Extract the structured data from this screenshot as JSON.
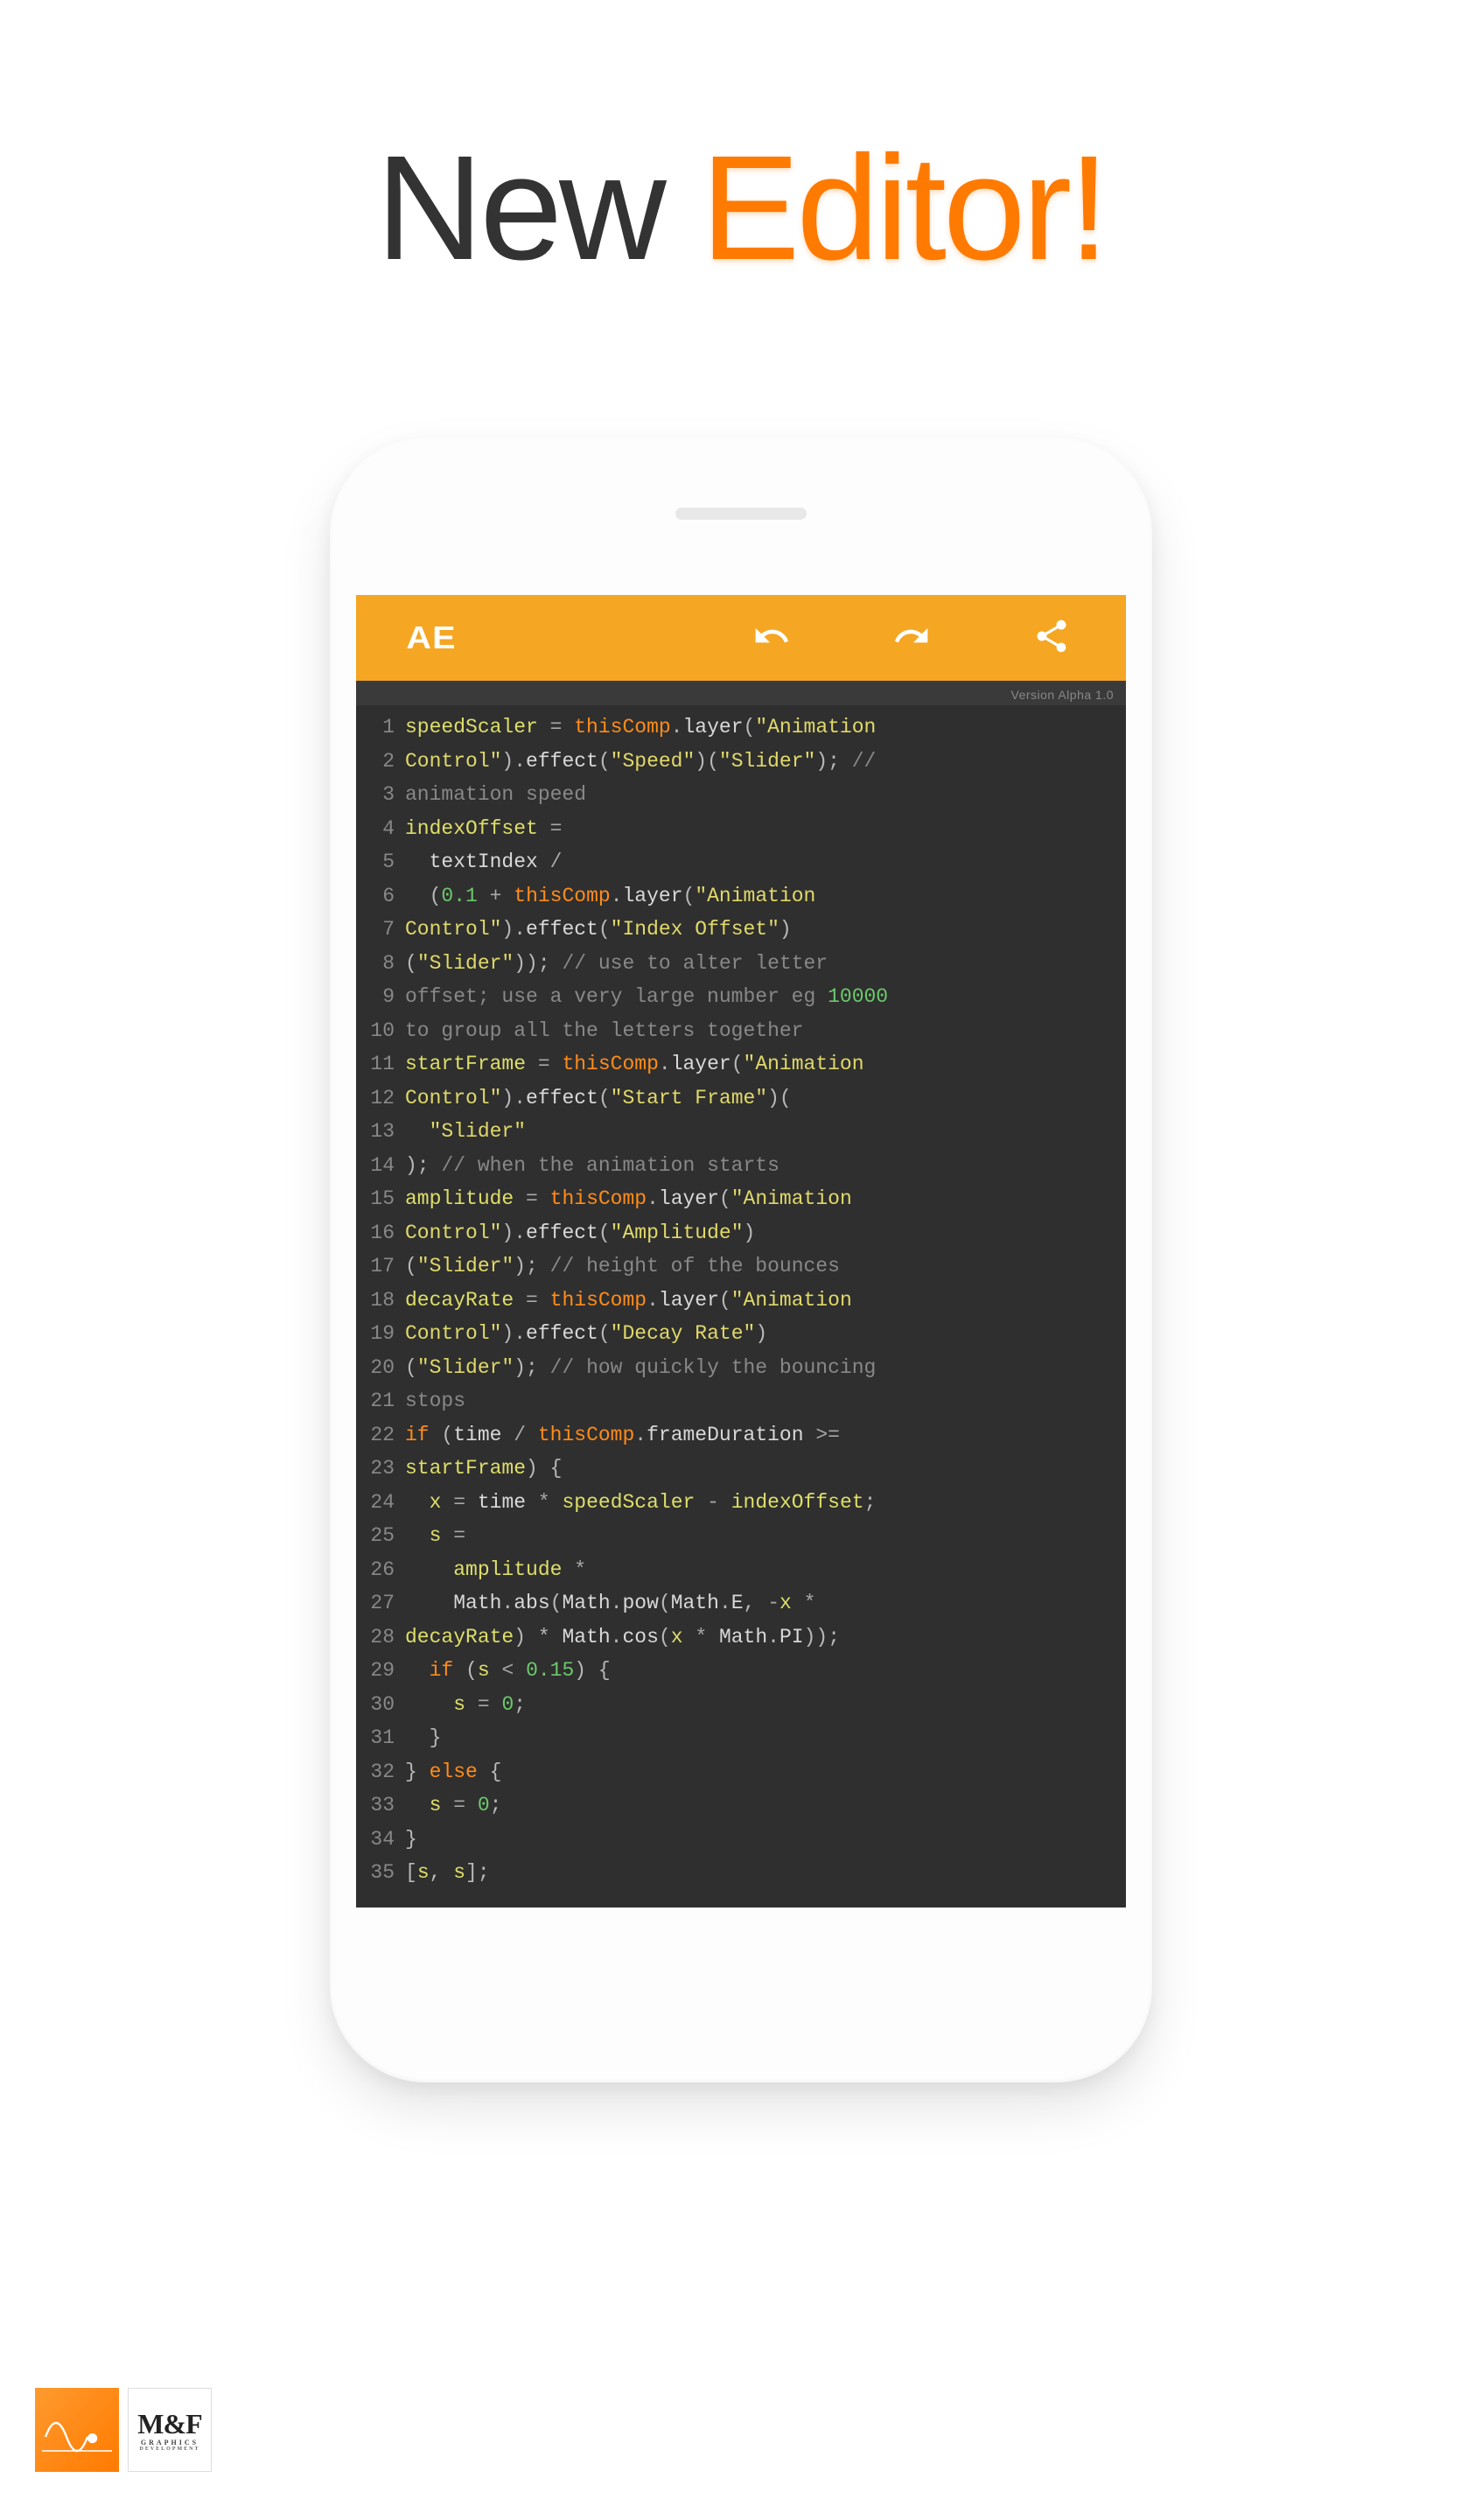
{
  "headline": {
    "word1": "New",
    "word2": "Editor!"
  },
  "toolbar": {
    "logo": "AE"
  },
  "version_label": "Version Alpha 1.0",
  "footer": {
    "logo2_big": "M&F",
    "logo2_small": "GRAPHICS",
    "logo2_small2": "DEVELOPMENT"
  },
  "code_lines": [
    {
      "n": 1,
      "tokens": [
        [
          "var",
          "speedScaler"
        ],
        [
          "op",
          " = "
        ],
        [
          "obj",
          "thisComp"
        ],
        [
          "punc",
          "."
        ],
        [
          "method",
          "layer"
        ],
        [
          "punc",
          "("
        ],
        [
          "str",
          "\"Animation"
        ]
      ]
    },
    {
      "n": 2,
      "tokens": [
        [
          "str",
          "Control\""
        ],
        [
          "punc",
          ")."
        ],
        [
          "method",
          "effect"
        ],
        [
          "punc",
          "("
        ],
        [
          "str",
          "\"Speed\""
        ],
        [
          "punc",
          ")("
        ],
        [
          "str",
          "\"Slider\""
        ],
        [
          "punc",
          "); "
        ],
        [
          "cmt",
          "//"
        ]
      ]
    },
    {
      "n": 3,
      "tokens": [
        [
          "cmt",
          "animation speed"
        ]
      ]
    },
    {
      "n": 4,
      "tokens": [
        [
          "var",
          "indexOffset"
        ],
        [
          "op",
          " ="
        ]
      ]
    },
    {
      "n": 5,
      "tokens": [
        [
          "method",
          "  textIndex"
        ],
        [
          "op",
          " /"
        ]
      ]
    },
    {
      "n": 6,
      "tokens": [
        [
          "punc",
          "  ("
        ],
        [
          "num",
          "0.1"
        ],
        [
          "op",
          " + "
        ],
        [
          "obj",
          "thisComp"
        ],
        [
          "punc",
          "."
        ],
        [
          "method",
          "layer"
        ],
        [
          "punc",
          "("
        ],
        [
          "str",
          "\"Animation"
        ]
      ]
    },
    {
      "n": 7,
      "tokens": [
        [
          "str",
          "Control\""
        ],
        [
          "punc",
          ")."
        ],
        [
          "method",
          "effect"
        ],
        [
          "punc",
          "("
        ],
        [
          "str",
          "\"Index Offset\""
        ],
        [
          "punc",
          ")"
        ]
      ]
    },
    {
      "n": 8,
      "tokens": [
        [
          "punc",
          "("
        ],
        [
          "str",
          "\"Slider\""
        ],
        [
          "punc",
          ")); "
        ],
        [
          "cmt",
          "// use to alter letter"
        ]
      ]
    },
    {
      "n": 9,
      "tokens": [
        [
          "cmt",
          "offset; use a very large number eg "
        ],
        [
          "num",
          "10000"
        ]
      ]
    },
    {
      "n": 10,
      "tokens": [
        [
          "cmt",
          "to group all the letters together"
        ]
      ]
    },
    {
      "n": 11,
      "tokens": [
        [
          "var",
          "startFrame"
        ],
        [
          "op",
          " = "
        ],
        [
          "obj",
          "thisComp"
        ],
        [
          "punc",
          "."
        ],
        [
          "method",
          "layer"
        ],
        [
          "punc",
          "("
        ],
        [
          "str",
          "\"Animation"
        ]
      ]
    },
    {
      "n": 12,
      "tokens": [
        [
          "str",
          "Control\""
        ],
        [
          "punc",
          ")."
        ],
        [
          "method",
          "effect"
        ],
        [
          "punc",
          "("
        ],
        [
          "str",
          "\"Start Frame\""
        ],
        [
          "punc",
          ")("
        ]
      ]
    },
    {
      "n": 13,
      "tokens": [
        [
          "str",
          "  \"Slider\""
        ]
      ]
    },
    {
      "n": 14,
      "tokens": [
        [
          "punc",
          "); "
        ],
        [
          "cmt",
          "// when the animation starts"
        ]
      ]
    },
    {
      "n": 15,
      "tokens": [
        [
          "var",
          "amplitude"
        ],
        [
          "op",
          " = "
        ],
        [
          "obj",
          "thisComp"
        ],
        [
          "punc",
          "."
        ],
        [
          "method",
          "layer"
        ],
        [
          "punc",
          "("
        ],
        [
          "str",
          "\"Animation"
        ]
      ]
    },
    {
      "n": 16,
      "tokens": [
        [
          "str",
          "Control\""
        ],
        [
          "punc",
          ")."
        ],
        [
          "method",
          "effect"
        ],
        [
          "punc",
          "("
        ],
        [
          "str",
          "\"Amplitude\""
        ],
        [
          "punc",
          ")"
        ]
      ]
    },
    {
      "n": 17,
      "tokens": [
        [
          "punc",
          "("
        ],
        [
          "str",
          "\"Slider\""
        ],
        [
          "punc",
          "); "
        ],
        [
          "cmt",
          "// height of the bounces"
        ]
      ]
    },
    {
      "n": 18,
      "tokens": [
        [
          "var",
          "decayRate"
        ],
        [
          "op",
          " = "
        ],
        [
          "obj",
          "thisComp"
        ],
        [
          "punc",
          "."
        ],
        [
          "method",
          "layer"
        ],
        [
          "punc",
          "("
        ],
        [
          "str",
          "\"Animation"
        ]
      ]
    },
    {
      "n": 19,
      "tokens": [
        [
          "str",
          "Control\""
        ],
        [
          "punc",
          ")."
        ],
        [
          "method",
          "effect"
        ],
        [
          "punc",
          "("
        ],
        [
          "str",
          "\"Decay Rate\""
        ],
        [
          "punc",
          ")"
        ]
      ]
    },
    {
      "n": 20,
      "tokens": [
        [
          "punc",
          "("
        ],
        [
          "str",
          "\"Slider\""
        ],
        [
          "punc",
          "); "
        ],
        [
          "cmt",
          "// how quickly the bouncing"
        ]
      ]
    },
    {
      "n": 21,
      "tokens": [
        [
          "cmt",
          "stops"
        ]
      ]
    },
    {
      "n": 22,
      "tokens": [
        [
          "kw",
          "if"
        ],
        [
          "punc",
          " ("
        ],
        [
          "method",
          "time"
        ],
        [
          "op",
          " / "
        ],
        [
          "obj",
          "thisComp"
        ],
        [
          "punc",
          "."
        ],
        [
          "method",
          "frameDuration"
        ],
        [
          "op",
          " >="
        ]
      ]
    },
    {
      "n": 23,
      "tokens": [
        [
          "var",
          "startFrame"
        ],
        [
          "punc",
          ") {"
        ]
      ]
    },
    {
      "n": 24,
      "tokens": [
        [
          "var",
          "  x"
        ],
        [
          "op",
          " = "
        ],
        [
          "method",
          "time"
        ],
        [
          "op",
          " * "
        ],
        [
          "var",
          "speedScaler"
        ],
        [
          "op",
          " - "
        ],
        [
          "var",
          "indexOffset"
        ],
        [
          "punc",
          ";"
        ]
      ]
    },
    {
      "n": 25,
      "tokens": [
        [
          "var",
          "  s"
        ],
        [
          "op",
          " ="
        ]
      ]
    },
    {
      "n": 26,
      "tokens": [
        [
          "var",
          "    amplitude"
        ],
        [
          "op",
          " *"
        ]
      ]
    },
    {
      "n": 27,
      "tokens": [
        [
          "method",
          "    Math"
        ],
        [
          "punc",
          "."
        ],
        [
          "method",
          "abs"
        ],
        [
          "punc",
          "("
        ],
        [
          "method",
          "Math"
        ],
        [
          "punc",
          "."
        ],
        [
          "method",
          "pow"
        ],
        [
          "punc",
          "("
        ],
        [
          "method",
          "Math"
        ],
        [
          "punc",
          "."
        ],
        [
          "method",
          "E"
        ],
        [
          "punc",
          ", "
        ],
        [
          "op",
          "-"
        ],
        [
          "var",
          "x"
        ],
        [
          "op",
          " *"
        ]
      ]
    },
    {
      "n": 28,
      "tokens": [
        [
          "var",
          "decayRate"
        ],
        [
          "punc",
          ") * "
        ],
        [
          "method",
          "Math"
        ],
        [
          "punc",
          "."
        ],
        [
          "method",
          "cos"
        ],
        [
          "punc",
          "("
        ],
        [
          "var",
          "x"
        ],
        [
          "op",
          " * "
        ],
        [
          "method",
          "Math"
        ],
        [
          "punc",
          "."
        ],
        [
          "method",
          "PI"
        ],
        [
          "punc",
          "));"
        ]
      ]
    },
    {
      "n": 29,
      "tokens": [
        [
          "kw",
          "  if"
        ],
        [
          "punc",
          " ("
        ],
        [
          "var",
          "s"
        ],
        [
          "op",
          " < "
        ],
        [
          "num",
          "0.15"
        ],
        [
          "punc",
          ") {"
        ]
      ]
    },
    {
      "n": 30,
      "tokens": [
        [
          "var",
          "    s"
        ],
        [
          "op",
          " = "
        ],
        [
          "num",
          "0"
        ],
        [
          "punc",
          ";"
        ]
      ]
    },
    {
      "n": 31,
      "tokens": [
        [
          "punc",
          "  }"
        ]
      ]
    },
    {
      "n": 32,
      "tokens": [
        [
          "punc",
          "} "
        ],
        [
          "kw",
          "else"
        ],
        [
          "punc",
          " {"
        ]
      ]
    },
    {
      "n": 33,
      "tokens": [
        [
          "var",
          "  s"
        ],
        [
          "op",
          " = "
        ],
        [
          "num",
          "0"
        ],
        [
          "punc",
          ";"
        ]
      ]
    },
    {
      "n": 34,
      "tokens": [
        [
          "punc",
          "}"
        ]
      ]
    },
    {
      "n": 35,
      "tokens": [
        [
          "punc",
          "["
        ],
        [
          "var",
          "s"
        ],
        [
          "punc",
          ", "
        ],
        [
          "var",
          "s"
        ],
        [
          "punc",
          "];"
        ]
      ]
    }
  ]
}
